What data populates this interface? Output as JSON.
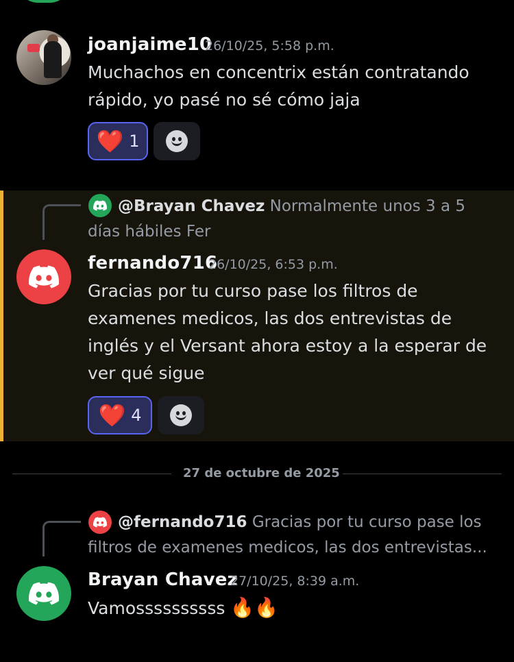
{
  "colors": {
    "background": "#000000",
    "highlight_bg": "#17140c",
    "highlight_bar": "#f0b132",
    "discord_red": "#ed4245",
    "discord_green": "#23a55a",
    "reaction_active_bg": "#2b2e5a",
    "reaction_active_border": "#5865f2"
  },
  "messages": [
    {
      "username": "joanjaime10",
      "timestamp": "26/10/25, 5:58 p.m.",
      "avatar_icon": "user-photo-avatar",
      "text": "Muchachos en concentrix están contratando rápido, yo pasé no sé cómo jaja",
      "reactions": [
        {
          "emoji": "❤️",
          "icon": "heart-emoji",
          "count": "1"
        }
      ]
    },
    {
      "reply": {
        "mention": "@Brayan Chavez",
        "text": "Normalmente unos 3 a 5 días hábiles Fer",
        "avatar_icon": "discord-logo-icon"
      },
      "username": "fernando716",
      "timestamp": "26/10/25, 6:53 p.m.",
      "avatar_icon": "discord-logo-icon",
      "text": "Gracias por tu curso pase los filtros de examenes medicos, las dos entrevistas de inglés y el Versant ahora estoy a la esperar de ver qué sigue",
      "reactions": [
        {
          "emoji": "❤️",
          "icon": "heart-emoji",
          "count": "4"
        }
      ]
    },
    {
      "reply": {
        "mention": "@fernando716",
        "text": "Gracias por tu curso pase los filtros de examenes medicos, las dos entrevistas...",
        "avatar_icon": "discord-logo-icon"
      },
      "username": "Brayan Chavez",
      "timestamp": "27/10/25, 8:39 a.m.",
      "avatar_icon": "discord-logo-icon",
      "text": "Vamossssssssss",
      "emoji_suffix": "🔥🔥"
    }
  ],
  "date_divider": "27 de octubre de 2025",
  "add_reaction_icon": "add-reaction-smiley-icon"
}
